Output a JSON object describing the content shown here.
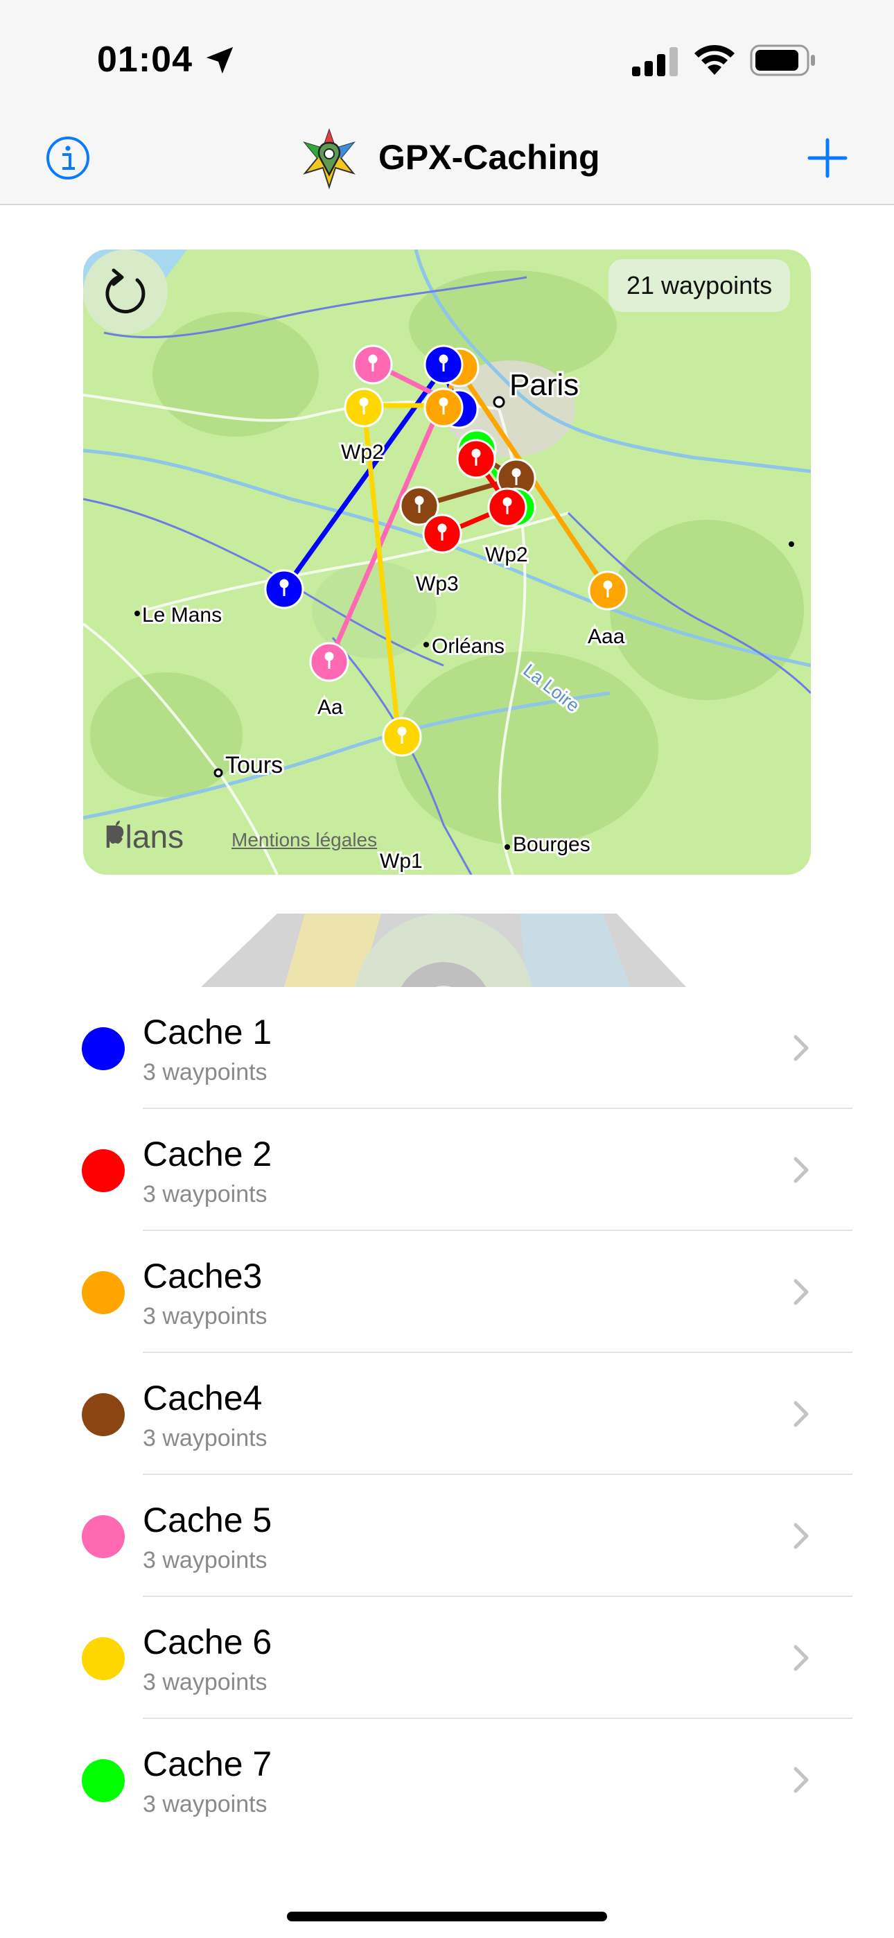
{
  "status_bar": {
    "time": "01:04"
  },
  "nav": {
    "title": "GPX-Caching"
  },
  "map": {
    "waypoint_count_label": "21 waypoints",
    "attribution": "Plans",
    "legal_label": "Mentions légales",
    "city_labels": [
      "Paris",
      "Le Mans",
      "Orléans",
      "Tours",
      "Bourges",
      "La Loire"
    ],
    "waypoint_labels": [
      "Wp2",
      "Wp3",
      "Wp2",
      "Aaa",
      "Aa",
      "Wp1"
    ]
  },
  "caches": [
    {
      "name": "Cache 1",
      "subtitle": "3 waypoints",
      "color": "#0000ff"
    },
    {
      "name": "Cache 2",
      "subtitle": "3 waypoints",
      "color": "#ff0000"
    },
    {
      "name": "Cache3",
      "subtitle": "3 waypoints",
      "color": "#ffa500"
    },
    {
      "name": "Cache4",
      "subtitle": "3 waypoints",
      "color": "#8b4513"
    },
    {
      "name": "Cache 5",
      "subtitle": "3 waypoints",
      "color": "#ff69b4"
    },
    {
      "name": "Cache 6",
      "subtitle": "3 waypoints",
      "color": "#ffd700"
    },
    {
      "name": "Cache 7",
      "subtitle": "3 waypoints",
      "color": "#00ff00"
    }
  ]
}
